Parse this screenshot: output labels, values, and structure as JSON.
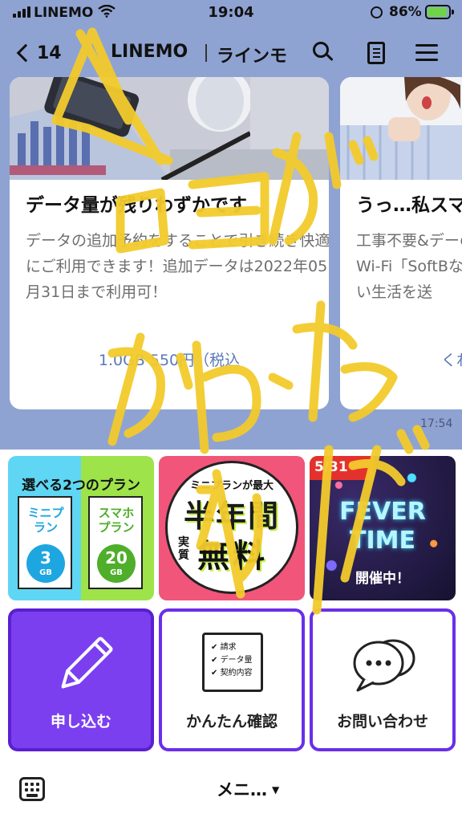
{
  "status": {
    "carrier": "LINEMO",
    "time": "19:04",
    "battery_percent": "86%"
  },
  "header": {
    "back_count": "14",
    "title": "LINEMO",
    "subtitle": "ラインモ"
  },
  "messages": {
    "card1": {
      "title": "データ量が残りわずかです",
      "body": "データの追加予約をすることで引き続き快適にご利用できます！追加データは2022年05月31日まで利用可！",
      "link": "1.0GB 550円（税込"
    },
    "card2": {
      "title": "うっ…私スマ",
      "body": "工事不要&デーのWi-Fi「SoftBない生活を送",
      "link": "くわ"
    },
    "timestamp": "17:54"
  },
  "rich_menu": {
    "banner1": {
      "heading": "選べる2つのプラン",
      "plan1": "ミニプラン",
      "plan1_amount": "3",
      "plan2": "スマホプラン",
      "plan2_amount": "20",
      "unit": "GB"
    },
    "banner2": {
      "top": "ミニプランが最大",
      "line1": "半年間",
      "small": "実質",
      "line2": "無料"
    },
    "banner3": {
      "date": "5/31",
      "line1": "FEVER",
      "line2": "TIME",
      "sub": "開催中！"
    },
    "apply_label": "申し込む",
    "check_label": "かんたん確認",
    "check_items": [
      "請求",
      "データ量",
      "契約内容"
    ],
    "contact_label": "お問い合わせ"
  },
  "bottom": {
    "menu_label": "メニ…"
  },
  "colors": {
    "chat_bg": "#8fa3d2",
    "accent": "#7b3ff0",
    "scribble": "#f3cb2c"
  }
}
